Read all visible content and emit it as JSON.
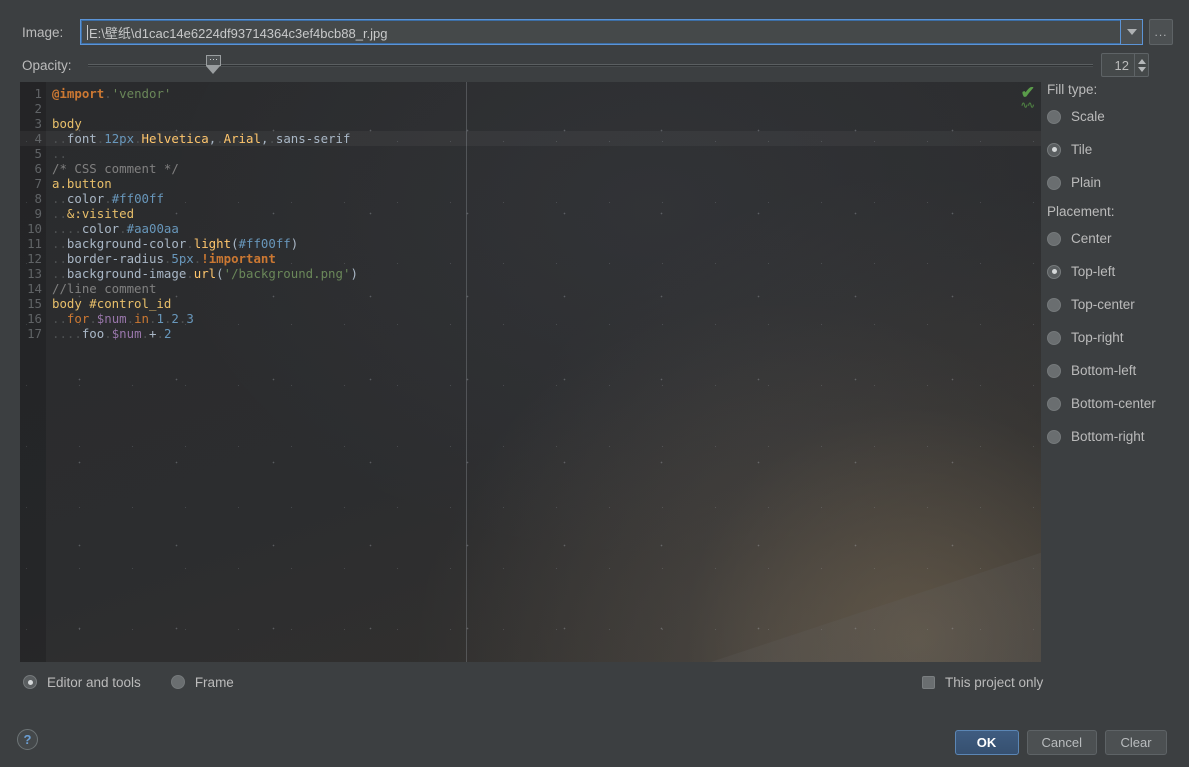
{
  "form": {
    "image_label": "Image:",
    "image_path": "E:\\壁纸\\d1cac14e6224df93714364c3ef4bcb88_r.jpg",
    "image_placeholder": "",
    "dropdown_icon": "chevron-down-icon",
    "browse_label": "...",
    "opacity_label": "Opacity:",
    "opacity_value": "12"
  },
  "preview": {
    "inspection_icon": "checkmark-ok-icon",
    "inspection_glyph": "✔",
    "code_lines": [
      {
        "n": "1",
        "current": false,
        "html": "<span class=\"k-at\">@import</span><span class=\"k-dot\">.</span><span class=\"k-str\">'vendor'</span>"
      },
      {
        "n": "2",
        "current": false,
        "html": ""
      },
      {
        "n": "3",
        "current": false,
        "html": "<span class=\"k-tag\">body</span>"
      },
      {
        "n": "4",
        "current": true,
        "html": "<span class=\"k-dot\">..</span><span class=\"k-txt\">font</span><span class=\"k-dot\">.</span><span class=\"k-num\">12px</span><span class=\"k-dot\">.</span><span class=\"k-fn\">Helvetica</span><span class=\"k-txt\">,</span><span class=\"k-dot\">.</span><span class=\"k-fn\">Arial</span><span class=\"k-txt\">,</span><span class=\"k-dot\">.</span><span class=\"k-txt\">sans-serif</span>"
      },
      {
        "n": "5",
        "current": false,
        "html": "<span class=\"k-dot\">..</span>"
      },
      {
        "n": "6",
        "current": false,
        "html": "<span class=\"k-com\">/* CSS comment */</span>"
      },
      {
        "n": "7",
        "current": false,
        "html": "<span class=\"k-tag\">a.button</span>"
      },
      {
        "n": "8",
        "current": false,
        "html": "<span class=\"k-dot\">..</span><span class=\"k-txt\">color</span><span class=\"k-dot\">.</span><span class=\"k-num\">#ff00ff</span>"
      },
      {
        "n": "9",
        "current": false,
        "html": "<span class=\"k-dot\">..</span><span class=\"k-tag\">&amp;:visited</span>"
      },
      {
        "n": "10",
        "current": false,
        "html": "<span class=\"k-dot\">....</span><span class=\"k-txt\">color</span><span class=\"k-dot\">.</span><span class=\"k-num\">#aa00aa</span>"
      },
      {
        "n": "11",
        "current": false,
        "html": "<span class=\"k-dot\">..</span><span class=\"k-txt\">background-color</span><span class=\"k-dot\">.</span><span class=\"k-fn\">light</span><span class=\"k-txt\">(</span><span class=\"k-num\">#ff00ff</span><span class=\"k-txt\">)</span>"
      },
      {
        "n": "12",
        "current": false,
        "html": "<span class=\"k-dot\">..</span><span class=\"k-txt\">border-radius</span><span class=\"k-dot\">.</span><span class=\"k-num\">5px</span><span class=\"k-dot\">.</span><span class=\"k-imp\">!important</span>"
      },
      {
        "n": "13",
        "current": false,
        "html": "<span class=\"k-dot\">..</span><span class=\"k-txt\">background-image</span><span class=\"k-dot\">.</span><span class=\"k-fn\">url</span><span class=\"k-txt\">(</span><span class=\"k-str\">'/background.png'</span><span class=\"k-txt\">)</span>"
      },
      {
        "n": "14",
        "current": false,
        "html": "<span class=\"k-com\">//line comment</span>"
      },
      {
        "n": "15",
        "current": false,
        "html": "<span class=\"k-tag\">body #control_id</span>"
      },
      {
        "n": "16",
        "current": false,
        "html": "<span class=\"k-dot\">..</span><span class=\"k-kw\">for</span><span class=\"k-dot\">.</span><span class=\"k-var\">$num</span><span class=\"k-dot\">.</span><span class=\"k-kw\">in</span><span class=\"k-dot\">.</span><span class=\"k-num\">1</span><span class=\"k-dot\">.</span><span class=\"k-num\">2</span><span class=\"k-dot\">.</span><span class=\"k-num\">3</span>"
      },
      {
        "n": "17",
        "current": false,
        "html": "<span class=\"k-dot\">....</span><span class=\"k-txt\">foo</span><span class=\"k-dot\">.</span><span class=\"k-var\">$num</span><span class=\"k-dot\">.</span><span class=\"k-txt\">+</span><span class=\"k-dot\">.</span><span class=\"k-num\">2</span>"
      }
    ]
  },
  "options": {
    "fill_type_title": "Fill type:",
    "fill_type": [
      {
        "label": "Scale",
        "selected": false
      },
      {
        "label": "Tile",
        "selected": true
      },
      {
        "label": "Plain",
        "selected": false
      }
    ],
    "placement_title": "Placement:",
    "placement": [
      {
        "label": "Center",
        "selected": false
      },
      {
        "label": "Top-left",
        "selected": true
      },
      {
        "label": "Top-center",
        "selected": false
      },
      {
        "label": "Top-right",
        "selected": false
      },
      {
        "label": "Bottom-left",
        "selected": false
      },
      {
        "label": "Bottom-center",
        "selected": false
      },
      {
        "label": "Bottom-right",
        "selected": false
      }
    ]
  },
  "scope": {
    "targets": [
      {
        "label": "Editor and tools",
        "selected": true
      },
      {
        "label": "Frame",
        "selected": false
      }
    ],
    "project_only_label": "This project only",
    "project_only_checked": false
  },
  "footer": {
    "help_label": "?",
    "ok_label": "OK",
    "cancel_label": "Cancel",
    "clear_label": "Clear"
  },
  "colors": {
    "dialog_bg": "#3c3f41",
    "editor_bg": "#2b2b2b",
    "accent_focus": "#5c94d6",
    "ok_button": "#3f5c80",
    "checkmark_green": "#5a9c4a"
  }
}
